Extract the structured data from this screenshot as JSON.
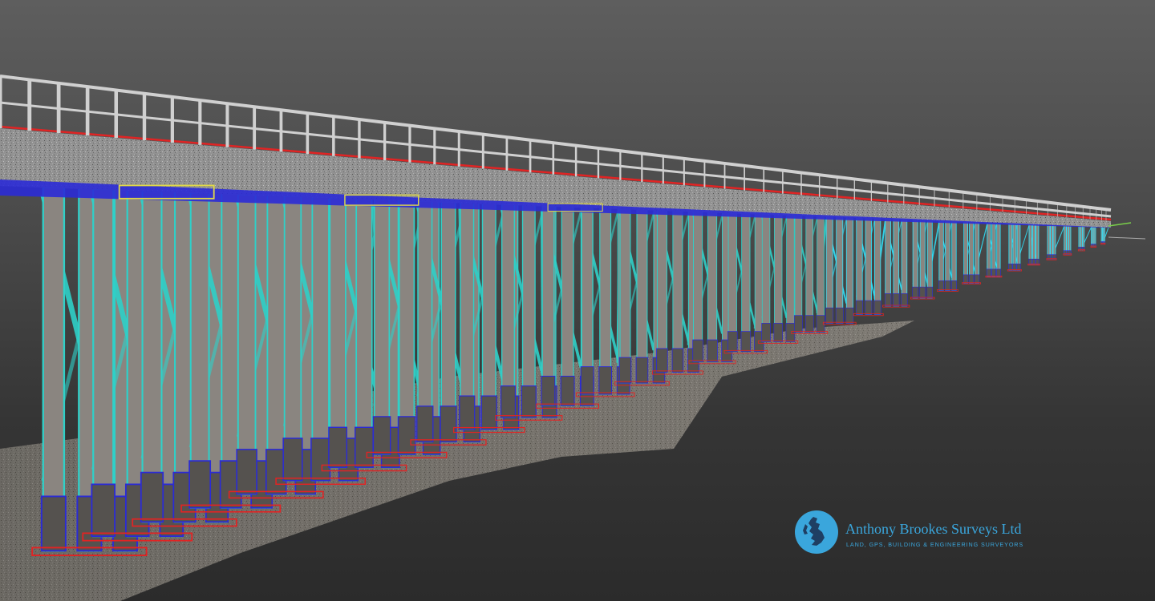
{
  "image": {
    "subject": "point cloud scan of pier",
    "colors": {
      "background_top": "#5e5e5e",
      "background_bottom": "#2b2b2b",
      "deck": "#9a9a9a",
      "railing": "#d0d0d0",
      "leg": "#2fd0c8",
      "leg_far": "#2ee6ff",
      "model_blue": "#2b2bd6",
      "model_red": "#e02424",
      "model_yellow": "#e0d84a",
      "ground": "#6b655c",
      "logo_blue": "#3aa6dc"
    }
  },
  "logo": {
    "name": "Anthony Brookes Surveys Ltd",
    "tagline": "LAND, GPS, BUILDING & ENGINEERING SURVEYORS",
    "icon": "globe-map-icon"
  }
}
